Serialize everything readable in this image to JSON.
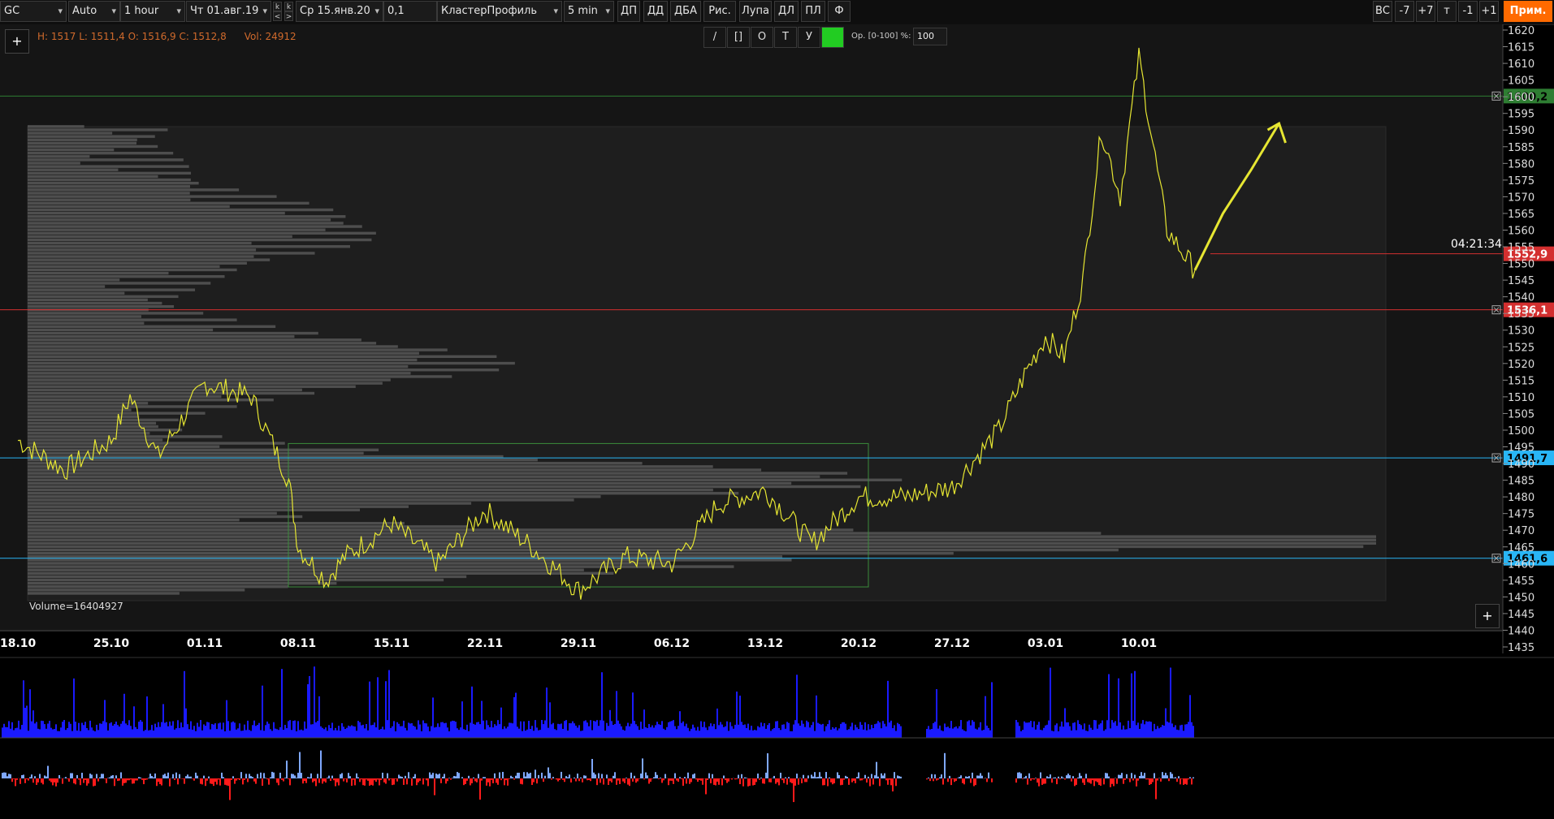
{
  "toolbar": {
    "symbol": "GC",
    "scale": "Auto",
    "timeframe": "1 hour",
    "date_from": "Чт 01.авг.19",
    "date_to": "Ср 15.янв.20",
    "tick_size": "0,1",
    "chart_type": "КластерПрофиль",
    "cluster_period": "5 min",
    "buttons": [
      "ДП",
      "ДД",
      "ДБА",
      "Рис.",
      "Лупа",
      "ДЛ",
      "ПЛ",
      "Ф"
    ],
    "right_buttons": [
      "ВС",
      "-7",
      "+7",
      "т",
      "-1",
      "+1"
    ],
    "apply_label": "Прим.",
    "k_left": "k",
    "k_right": "k",
    "arrow_left": "<",
    "arrow_right": ">"
  },
  "header": {
    "ohlc": "H: 1517 L: 1511,4 O: 1516,9 C: 1512,8",
    "volume": "Vol: 24912",
    "plus_label": "+"
  },
  "drawing_tools": {
    "tools": [
      "/",
      "[]",
      "O",
      "T",
      "У"
    ],
    "active_color": "#22cc22",
    "opacity_label": "Ор. [0-100] %:",
    "opacity_value": "100"
  },
  "profile": {
    "volume_label": "Volume=16404927"
  },
  "timer": "04:21:34",
  "colors": {
    "price_line": "#e6e632",
    "profile_fill": "#5a5a5a",
    "green_level": "#2e7d32",
    "red_level": "#d32f2f",
    "cyan_level": "#29b6f6",
    "volume_bar": "#1a1aff",
    "delta_pos": "#7fa8ff",
    "delta_neg": "#ff1a1a",
    "accent": "#ff6a00"
  },
  "chart_data": {
    "type": "line",
    "y_axis": {
      "range": [
        1435,
        1620
      ],
      "ticks": [
        "1620",
        "1615",
        "1610",
        "1605",
        "1600",
        "1595",
        "1590",
        "1585",
        "1580",
        "1575",
        "1570",
        "1565",
        "1560",
        "1555",
        "1550",
        "1545",
        "1540",
        "1535",
        "1530",
        "1525",
        "1520",
        "1515",
        "1510",
        "1505",
        "1500",
        "1495",
        "1490",
        "1485",
        "1480",
        "1475",
        "1470",
        "1465",
        "1460",
        "1455",
        "1450",
        "1445",
        "1440",
        "1435"
      ]
    },
    "x_axis": {
      "labels": [
        "18.10",
        "25.10",
        "01.11",
        "08.11",
        "15.11",
        "22.11",
        "29.11",
        "06.12",
        "13.12",
        "20.12",
        "27.12",
        "03.01",
        "10.01"
      ]
    },
    "price_levels": [
      {
        "label": "1600,2",
        "value": 1600.2,
        "color": "green"
      },
      {
        "label": "1552,9",
        "value": 1552.9,
        "color": "red"
      },
      {
        "label": "1536,1",
        "value": 1536.1,
        "color": "red"
      },
      {
        "label": "1491,7",
        "value": 1491.7,
        "color": "cyan"
      },
      {
        "label": "1461,6",
        "value": 1461.6,
        "color": "cyan"
      }
    ],
    "series": [
      {
        "x_index": [
          0,
          0.5,
          1,
          1.2,
          1.5,
          2,
          2.5,
          2.9,
          3,
          3.3,
          3.5,
          4,
          4.5,
          5,
          5.5,
          6,
          6.5,
          7,
          7.5,
          8,
          8.5,
          9,
          9.5,
          10,
          10.5,
          10.8,
          11,
          11.2,
          11.4,
          11.6,
          11.8,
          12,
          12.3,
          12.6
        ],
        "values": [
          1497,
          1488,
          1497,
          1510,
          1492,
          1514,
          1510,
          1485,
          1465,
          1455,
          1462,
          1472,
          1460,
          1476,
          1465,
          1452,
          1462,
          1460,
          1478,
          1482,
          1466,
          1480,
          1480,
          1483,
          1500,
          1518,
          1528,
          1522,
          1545,
          1590,
          1570,
          1612,
          1560,
          1548
        ]
      }
    ],
    "projection": {
      "x_index": [
        12.6,
        12.9,
        13.2,
        13.5
      ],
      "values": [
        1548,
        1565,
        1578,
        1592
      ]
    },
    "value_area_box": {
      "x_start": "08.11",
      "x_end": "20.12",
      "high": 1496,
      "low": 1453
    },
    "volume_profile_peak": 1467
  }
}
